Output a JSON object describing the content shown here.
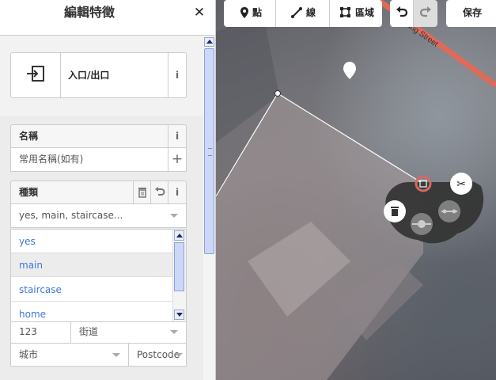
{
  "sidebar": {
    "title": "編輯特徵",
    "preset": {
      "name": "入口/出口"
    },
    "fields": {
      "name": {
        "label": "名稱",
        "placeholder": "常用名稱(如有)"
      },
      "type": {
        "label": "種類",
        "value": "yes, main, staircase..."
      },
      "type_options": [
        "yes",
        "main",
        "staircase",
        "home"
      ],
      "address": {
        "housenumber": "123",
        "street": "街道",
        "city": "城市",
        "postcode": "Postcode"
      }
    }
  },
  "toolbar": {
    "point": "點",
    "line": "線",
    "area": "區域",
    "save": "保存"
  },
  "map": {
    "street_label": "Yuchang Street"
  },
  "colors": {
    "link_blue": "#3c78d8",
    "street_red": "#e06a58",
    "vertex_selected": "#d56a5f"
  }
}
